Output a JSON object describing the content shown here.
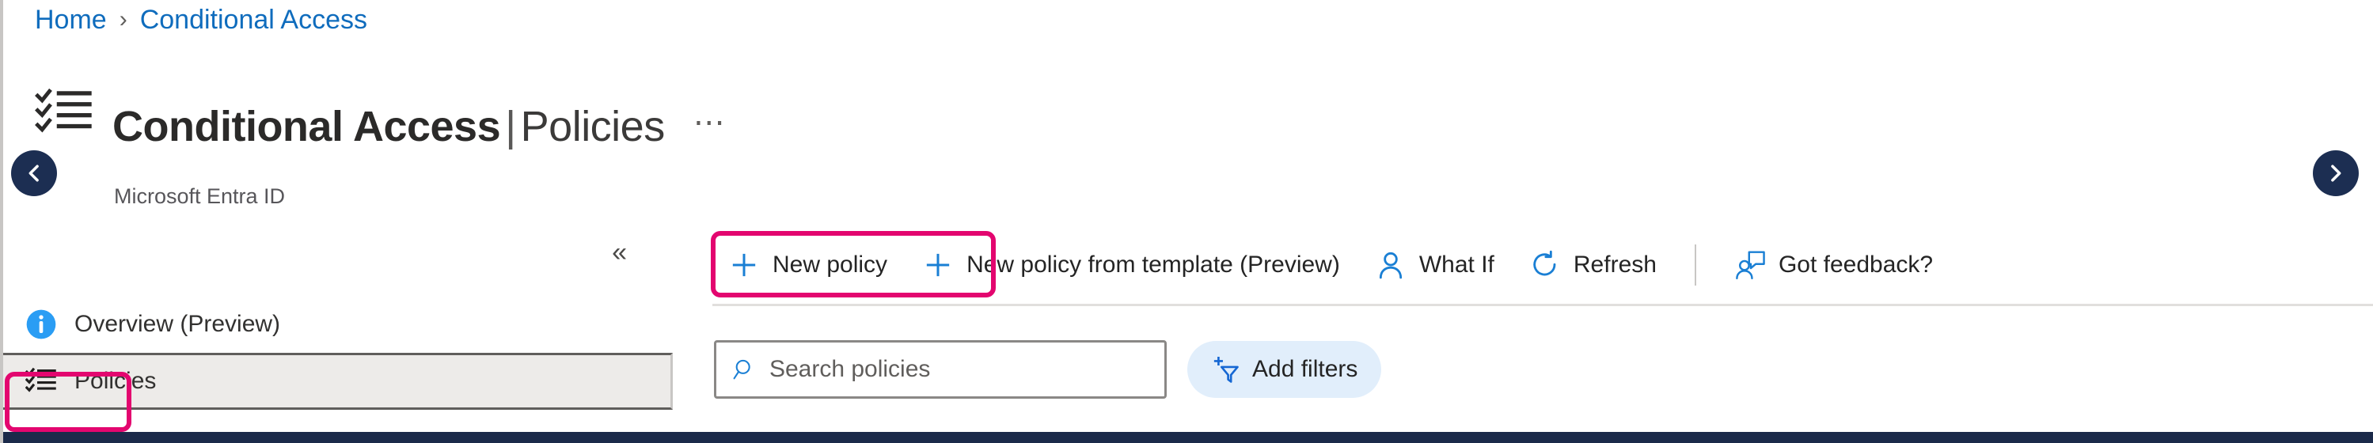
{
  "breadcrumb": {
    "items": [
      {
        "label": "Home"
      },
      {
        "label": "Conditional Access"
      }
    ],
    "separator": "›"
  },
  "header": {
    "icon": "checklist-icon",
    "title_bold": "Conditional Access",
    "title_separator": "|",
    "title_thin": "Policies",
    "overflow_label": "⋯",
    "subtitle": "Microsoft Entra ID"
  },
  "nav": {
    "prev_icon": "chevron-left-icon",
    "next_icon": "chevron-right-icon"
  },
  "sidebar": {
    "collapse_icon": "«",
    "items": [
      {
        "label": "Overview (Preview)",
        "icon": "info-circle-icon",
        "selected": false
      },
      {
        "label": "Policies",
        "icon": "checklist-icon",
        "selected": true
      }
    ]
  },
  "toolbar": {
    "commands": [
      {
        "label": "New policy",
        "icon": "plus-icon",
        "highlighted": true
      },
      {
        "label": "New policy from template (Preview)",
        "icon": "plus-icon",
        "highlighted": false
      },
      {
        "label": "What If",
        "icon": "person-icon",
        "highlighted": false
      },
      {
        "label": "Refresh",
        "icon": "refresh-icon",
        "highlighted": false
      }
    ],
    "feedback": {
      "label": "Got feedback?",
      "icon": "feedback-person-icon"
    }
  },
  "filters": {
    "search": {
      "placeholder": "Search policies",
      "value": "",
      "icon": "search-icon"
    },
    "add_filters": {
      "label": "Add filters",
      "icon": "add-filter-icon"
    }
  },
  "colors": {
    "link_blue": "#0f6cbd",
    "icon_blue": "#1a7fd4",
    "annotation_pink": "#e3066f",
    "navy": "#1c2e52",
    "selected_row": "#edebe9",
    "filter_pill": "#e1eefb"
  }
}
